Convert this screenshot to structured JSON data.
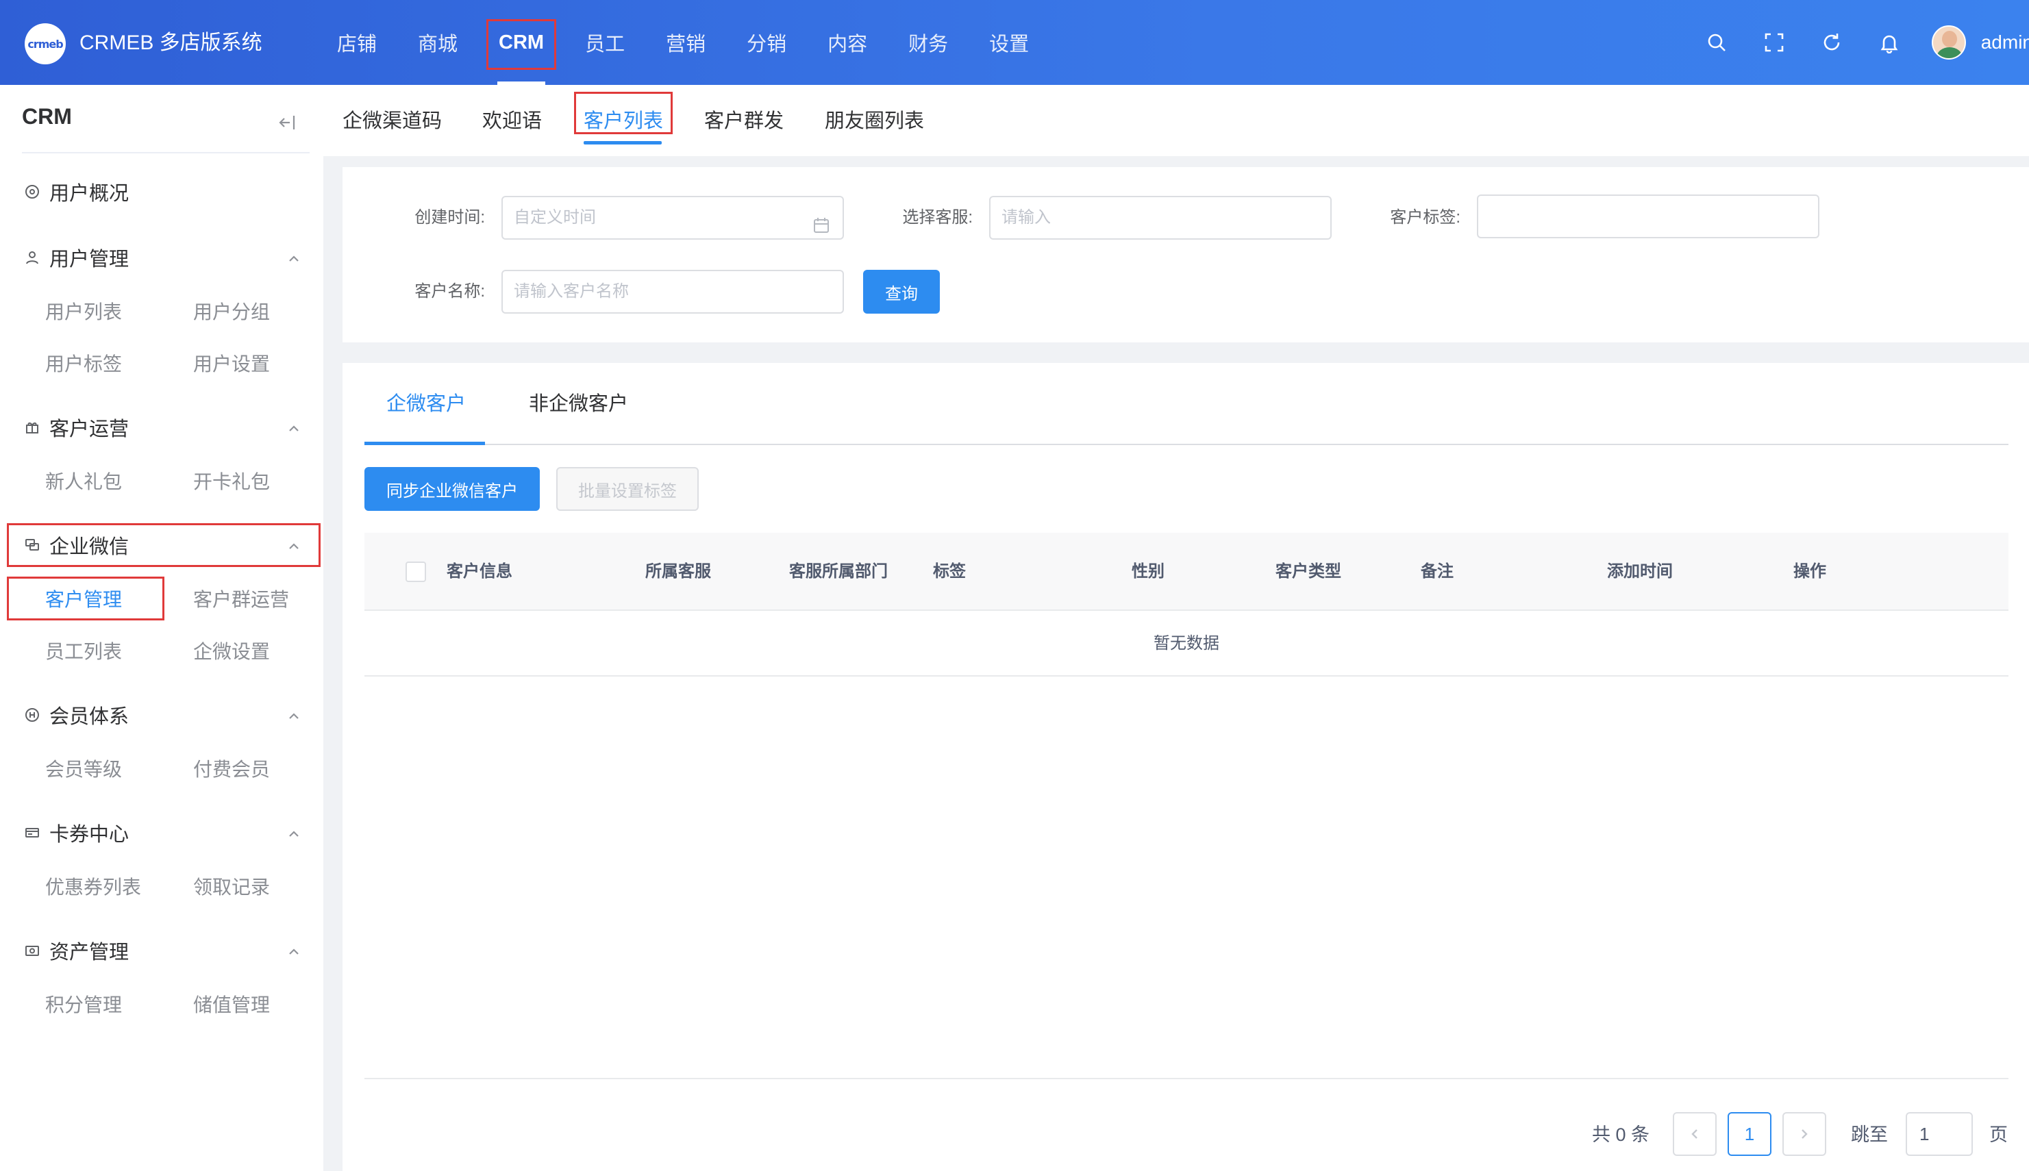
{
  "header": {
    "logo_text": "crmeb",
    "brand": "CRMEB 多店版系统",
    "nav": [
      "店铺",
      "商城",
      "CRM",
      "员工",
      "营销",
      "分销",
      "内容",
      "财务",
      "设置"
    ],
    "active_nav": "CRM",
    "username": "admin"
  },
  "sidebar": {
    "title": "CRM",
    "groups": [
      {
        "label": "用户概况",
        "icon": "dashboard-icon",
        "items": []
      },
      {
        "label": "用户管理",
        "icon": "user-icon",
        "items": [
          "用户列表",
          "用户分组",
          "用户标签",
          "用户设置"
        ]
      },
      {
        "label": "客户运营",
        "icon": "gift-icon",
        "items": [
          "新人礼包",
          "开卡礼包"
        ]
      },
      {
        "label": "企业微信",
        "icon": "chat-icon",
        "items": [
          "客户管理",
          "客户群运营",
          "员工列表",
          "企微设置"
        ]
      },
      {
        "label": "会员体系",
        "icon": "member-icon",
        "items": [
          "会员等级",
          "付费会员"
        ]
      },
      {
        "label": "卡券中心",
        "icon": "card-icon",
        "items": [
          "优惠券列表",
          "领取记录"
        ]
      },
      {
        "label": "资产管理",
        "icon": "wallet-icon",
        "items": [
          "积分管理",
          "储值管理"
        ]
      }
    ],
    "active_item": "客户管理"
  },
  "subtabs": [
    "企微渠道码",
    "欢迎语",
    "客户列表",
    "客户群发",
    "朋友圈列表"
  ],
  "active_subtab": "客户列表",
  "filters": {
    "create_time_label": "创建时间:",
    "create_time_placeholder": "自定义时间",
    "service_label": "选择客服:",
    "service_placeholder": "请输入",
    "tag_label": "客户标签:",
    "tag_value": "",
    "name_label": "客户名称:",
    "name_placeholder": "请输入客户名称",
    "search_button": "查询"
  },
  "list": {
    "tabs": [
      "企微客户",
      "非企微客户"
    ],
    "active_tab": "企微客户",
    "sync_button": "同步企业微信客户",
    "batch_tag_button": "批量设置标签",
    "columns": [
      "客户信息",
      "所属客服",
      "客服所属部门",
      "标签",
      "性别",
      "客户类型",
      "备注",
      "添加时间",
      "操作"
    ],
    "empty_text": "暂无数据"
  },
  "pagination": {
    "total_text": "共 0 条",
    "current_page": "1",
    "jump_label": "跳至",
    "jump_value": "1",
    "page_suffix": "页"
  },
  "colors": {
    "header_start": "#2f5fd6",
    "header_end": "#3b82ee",
    "primary": "#2d8cf0",
    "highlight_border": "#e03a3a"
  }
}
